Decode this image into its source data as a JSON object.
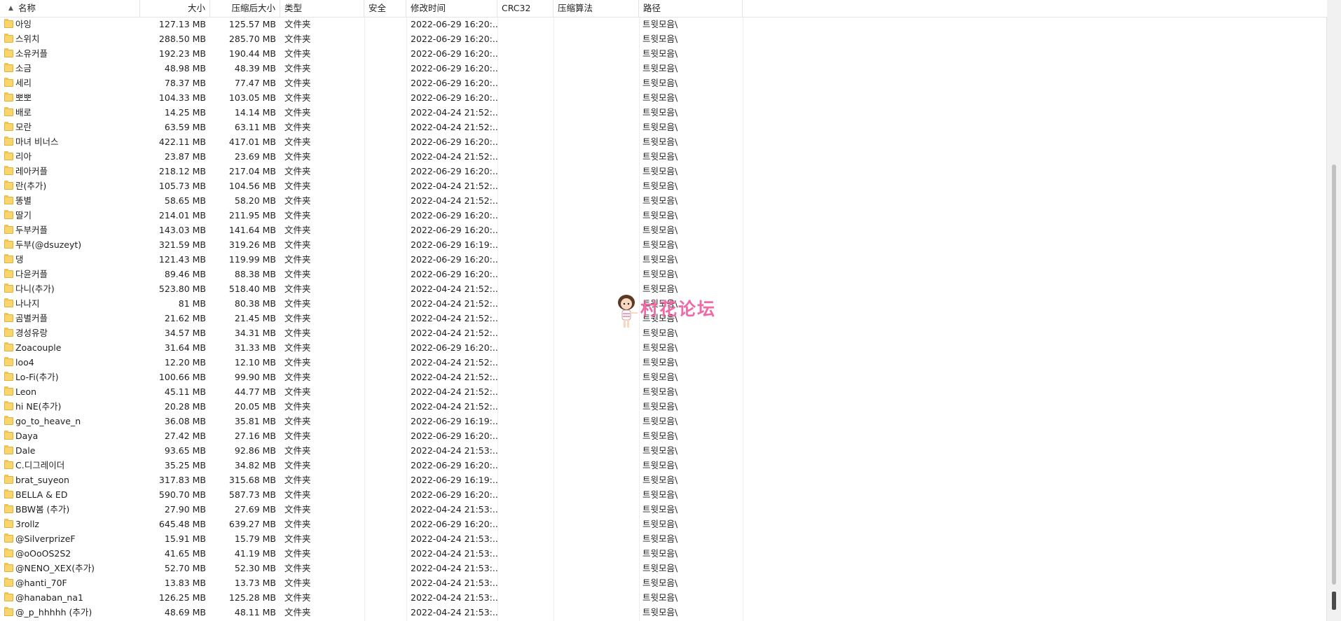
{
  "columns": {
    "name": "名称",
    "size": "大小",
    "packed": "压缩后大小",
    "type": "类型",
    "security": "安全",
    "modified": "修改时间",
    "crc": "CRC32",
    "method": "压缩算法",
    "path": "路径"
  },
  "watermark": {
    "text": "村花论坛"
  },
  "rows": [
    {
      "name": "아잉",
      "size": "127.13 MB",
      "packed": "125.57 MB",
      "type": "文件夹",
      "modified": "2022-06-29 16:20:...",
      "path": "트윗모음\\"
    },
    {
      "name": "스위치",
      "size": "288.50 MB",
      "packed": "285.70 MB",
      "type": "文件夹",
      "modified": "2022-06-29 16:20:...",
      "path": "트윗모음\\"
    },
    {
      "name": "소유커플",
      "size": "192.23 MB",
      "packed": "190.44 MB",
      "type": "文件夹",
      "modified": "2022-06-29 16:20:...",
      "path": "트윗모음\\"
    },
    {
      "name": "소금",
      "size": "48.98 MB",
      "packed": "48.39 MB",
      "type": "文件夹",
      "modified": "2022-06-29 16:20:...",
      "path": "트윗모음\\"
    },
    {
      "name": "세리",
      "size": "78.37 MB",
      "packed": "77.47 MB",
      "type": "文件夹",
      "modified": "2022-06-29 16:20:...",
      "path": "트윗모음\\"
    },
    {
      "name": "뽀뽀",
      "size": "104.33 MB",
      "packed": "103.05 MB",
      "type": "文件夹",
      "modified": "2022-06-29 16:20:...",
      "path": "트윗모음\\"
    },
    {
      "name": "배로",
      "size": "14.25 MB",
      "packed": "14.14 MB",
      "type": "文件夹",
      "modified": "2022-04-24 21:52:...",
      "path": "트윗모음\\"
    },
    {
      "name": "모란",
      "size": "63.59 MB",
      "packed": "63.11 MB",
      "type": "文件夹",
      "modified": "2022-04-24 21:52:...",
      "path": "트윗모음\\"
    },
    {
      "name": "마녀 비너스",
      "size": "422.11 MB",
      "packed": "417.01 MB",
      "type": "文件夹",
      "modified": "2022-06-29 16:20:...",
      "path": "트윗모음\\"
    },
    {
      "name": "리아",
      "size": "23.87 MB",
      "packed": "23.69 MB",
      "type": "文件夹",
      "modified": "2022-04-24 21:52:...",
      "path": "트윗모음\\"
    },
    {
      "name": "레아커플",
      "size": "218.12 MB",
      "packed": "217.04 MB",
      "type": "文件夹",
      "modified": "2022-06-29 16:20:...",
      "path": "트윗모음\\"
    },
    {
      "name": "란(추가)",
      "size": "105.73 MB",
      "packed": "104.56 MB",
      "type": "文件夹",
      "modified": "2022-04-24 21:52:...",
      "path": "트윗모음\\"
    },
    {
      "name": "똥별",
      "size": "58.65 MB",
      "packed": "58.20 MB",
      "type": "文件夹",
      "modified": "2022-04-24 21:52:...",
      "path": "트윗모음\\"
    },
    {
      "name": "딸기",
      "size": "214.01 MB",
      "packed": "211.95 MB",
      "type": "文件夹",
      "modified": "2022-06-29 16:20:...",
      "path": "트윗모음\\"
    },
    {
      "name": "두부커플",
      "size": "143.03 MB",
      "packed": "141.64 MB",
      "type": "文件夹",
      "modified": "2022-06-29 16:20:...",
      "path": "트윗모음\\"
    },
    {
      "name": "두부(@dsuzeyt)",
      "size": "321.59 MB",
      "packed": "319.26 MB",
      "type": "文件夹",
      "modified": "2022-06-29 16:19:...",
      "path": "트윗모음\\"
    },
    {
      "name": "댕",
      "size": "121.43 MB",
      "packed": "119.99 MB",
      "type": "文件夹",
      "modified": "2022-06-29 16:20:...",
      "path": "트윗모음\\"
    },
    {
      "name": "다윤커플",
      "size": "89.46 MB",
      "packed": "88.38 MB",
      "type": "文件夹",
      "modified": "2022-06-29 16:20:...",
      "path": "트윗모음\\"
    },
    {
      "name": "다니(추가)",
      "size": "523.80 MB",
      "packed": "518.40 MB",
      "type": "文件夹",
      "modified": "2022-04-24 21:52:...",
      "path": "트윗모음\\"
    },
    {
      "name": "나나지",
      "size": "81 MB",
      "packed": "80.38 MB",
      "type": "文件夹",
      "modified": "2022-04-24 21:52:...",
      "path": "트윗모음\\"
    },
    {
      "name": "곰별커플",
      "size": "21.62 MB",
      "packed": "21.45 MB",
      "type": "文件夹",
      "modified": "2022-04-24 21:52:...",
      "path": "트윗모음\\"
    },
    {
      "name": "경성유랑",
      "size": "34.57 MB",
      "packed": "34.31 MB",
      "type": "文件夹",
      "modified": "2022-04-24 21:52:...",
      "path": "트윗모음\\"
    },
    {
      "name": "Zoacouple",
      "size": "31.64 MB",
      "packed": "31.33 MB",
      "type": "文件夹",
      "modified": "2022-06-29 16:20:...",
      "path": "트윗모음\\"
    },
    {
      "name": "loo4",
      "size": "12.20 MB",
      "packed": "12.10 MB",
      "type": "文件夹",
      "modified": "2022-04-24 21:52:...",
      "path": "트윗모음\\"
    },
    {
      "name": "Lo-Fi(추가)",
      "size": "100.66 MB",
      "packed": "99.90 MB",
      "type": "文件夹",
      "modified": "2022-04-24 21:52:...",
      "path": "트윗모음\\"
    },
    {
      "name": "Leon",
      "size": "45.11 MB",
      "packed": "44.77 MB",
      "type": "文件夹",
      "modified": "2022-04-24 21:52:...",
      "path": "트윗모음\\"
    },
    {
      "name": "hi NE(추가)",
      "size": "20.28 MB",
      "packed": "20.05 MB",
      "type": "文件夹",
      "modified": "2022-04-24 21:52:...",
      "path": "트윗모음\\"
    },
    {
      "name": "go_to_heave_n",
      "size": "36.08 MB",
      "packed": "35.81 MB",
      "type": "文件夹",
      "modified": "2022-06-29 16:19:...",
      "path": "트윗모음\\"
    },
    {
      "name": "Daya",
      "size": "27.42 MB",
      "packed": "27.16 MB",
      "type": "文件夹",
      "modified": "2022-06-29 16:20:...",
      "path": "트윗모음\\"
    },
    {
      "name": "Dale",
      "size": "93.65 MB",
      "packed": "92.86 MB",
      "type": "文件夹",
      "modified": "2022-04-24 21:53:...",
      "path": "트윗모음\\"
    },
    {
      "name": "C.디그레이더",
      "size": "35.25 MB",
      "packed": "34.82 MB",
      "type": "文件夹",
      "modified": "2022-06-29 16:20:...",
      "path": "트윗모음\\"
    },
    {
      "name": "brat_suyeon",
      "size": "317.83 MB",
      "packed": "315.68 MB",
      "type": "文件夹",
      "modified": "2022-06-29 16:19:...",
      "path": "트윗모음\\"
    },
    {
      "name": "BELLA & ED",
      "size": "590.70 MB",
      "packed": "587.73 MB",
      "type": "文件夹",
      "modified": "2022-06-29 16:20:...",
      "path": "트윗모음\\"
    },
    {
      "name": "BBW봄 (추가)",
      "size": "27.90 MB",
      "packed": "27.69 MB",
      "type": "文件夹",
      "modified": "2022-04-24 21:53:...",
      "path": "트윗모음\\"
    },
    {
      "name": "3rollz",
      "size": "645.48 MB",
      "packed": "639.27 MB",
      "type": "文件夹",
      "modified": "2022-06-29 16:20:...",
      "path": "트윗모음\\"
    },
    {
      "name": "@SilverprizeF",
      "size": "15.91 MB",
      "packed": "15.79 MB",
      "type": "文件夹",
      "modified": "2022-04-24 21:53:...",
      "path": "트윗모음\\"
    },
    {
      "name": "@oOoOS2S2",
      "size": "41.65 MB",
      "packed": "41.19 MB",
      "type": "文件夹",
      "modified": "2022-04-24 21:53:...",
      "path": "트윗모음\\"
    },
    {
      "name": "@NENO_XEX(추가)",
      "size": "52.70 MB",
      "packed": "52.30 MB",
      "type": "文件夹",
      "modified": "2022-04-24 21:53:...",
      "path": "트윗모음\\"
    },
    {
      "name": "@hanti_70F",
      "size": "13.83 MB",
      "packed": "13.73 MB",
      "type": "文件夹",
      "modified": "2022-04-24 21:53:...",
      "path": "트윗모음\\"
    },
    {
      "name": "@hanaban_na1",
      "size": "126.25 MB",
      "packed": "125.28 MB",
      "type": "文件夹",
      "modified": "2022-04-24 21:53:...",
      "path": "트윗모음\\"
    },
    {
      "name": "@_p_hhhhh (추가)",
      "size": "48.69 MB",
      "packed": "48.11 MB",
      "type": "文件夹",
      "modified": "2022-04-24 21:53:...",
      "path": "트윗모음\\"
    }
  ]
}
